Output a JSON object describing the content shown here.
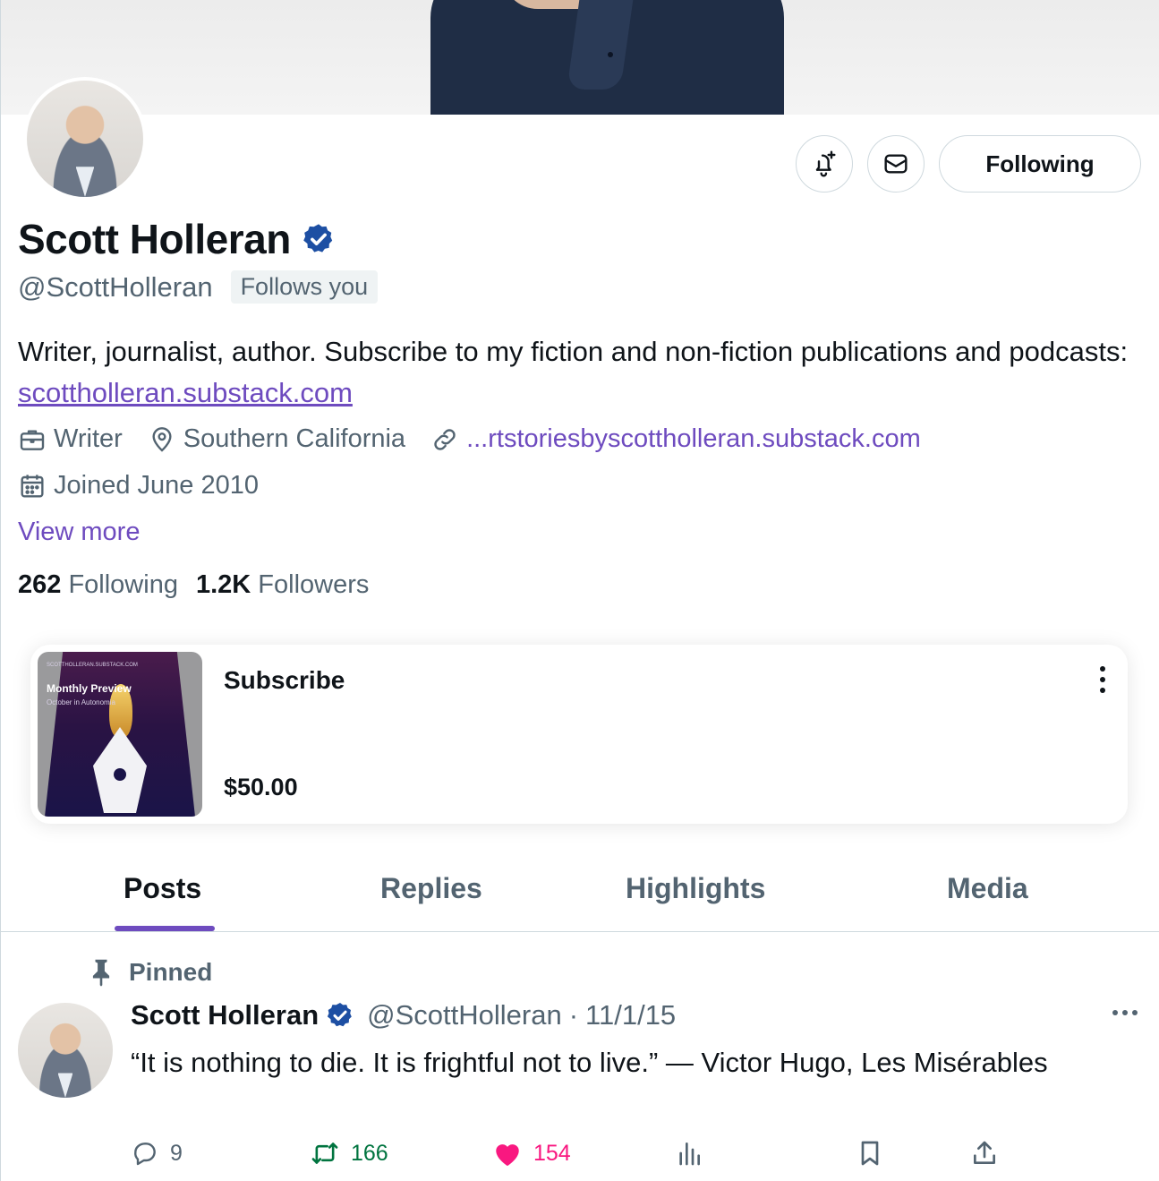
{
  "profile": {
    "name": "Scott Holleran",
    "handle": "@ScottHolleran",
    "follows_you": "Follows you",
    "bio_text": "Writer, journalist, author. Subscribe to my fiction and non-fiction publications and podcasts: ",
    "bio_link": "scottholleran.substack.com",
    "profession": "Writer",
    "location": "Southern California",
    "website": "...rtstoriesbyscottholleran.substack.com",
    "joined": "Joined June 2010",
    "view_more": "View more",
    "following_count": "262",
    "following_label": "Following",
    "followers_count": "1.2K",
    "followers_label": "Followers"
  },
  "header_actions": {
    "notify_icon": "bell-plus-icon",
    "message_icon": "envelope-icon",
    "follow_label": "Following"
  },
  "subscription": {
    "thumb_site": "SCOTTHOLLERAN.SUBSTACK.COM",
    "thumb_title": "Monthly Preview",
    "thumb_subtitle": "October in Autonomia",
    "title": "Subscribe",
    "price": "$50.00"
  },
  "tabs": [
    {
      "label": "Posts",
      "active": true
    },
    {
      "label": "Replies",
      "active": false
    },
    {
      "label": "Highlights",
      "active": false
    },
    {
      "label": "Media",
      "active": false
    }
  ],
  "pinned_post": {
    "pinned_label": "Pinned",
    "author": "Scott Holleran",
    "handle": "@ScottHolleran",
    "separator": "·",
    "date": "11/1/15",
    "text": "“It is nothing to die. It is frightful not to live.” — Victor Hugo, Les Misérables",
    "replies": "9",
    "reposts": "166",
    "likes": "154"
  },
  "colors": {
    "accent": "#6e4bbf",
    "verified": "#1d4fa3",
    "like": "#f91880",
    "repost": "#00743f",
    "muted": "#536471"
  }
}
